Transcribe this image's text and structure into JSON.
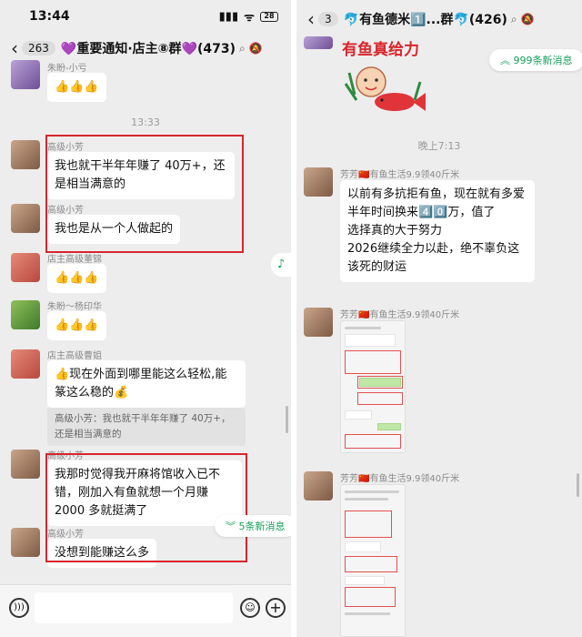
{
  "left": {
    "status": {
      "time": "13:44",
      "battery": "28"
    },
    "header": {
      "back_count": "263",
      "title": "💜重要通知·店主⑧群💜(473)"
    },
    "top_partial_name": "朱盼-小亏",
    "top_partial_text": "👍👍👍",
    "timestamp": "13:33",
    "messages": [
      {
        "name": "高级小芳",
        "text": "我也就干半年年赚了 40万+，还是相当满意的"
      },
      {
        "name": "高级小芳",
        "text": "我也是从一个人做起的"
      },
      {
        "name": "店主高级董锦",
        "text": "👍👍👍"
      },
      {
        "name": "朱盼～杨印华",
        "text": "👍👍👍"
      },
      {
        "name": "店主高级曹姐",
        "text": "👍现在外面到哪里能这么轻松,能篆这么稳的💰"
      },
      {
        "name": "高级小芳",
        "text": "我那时觉得我开麻将馆收入已不错，刚加入有鱼就想一个月赚 2000 多就挺满了"
      },
      {
        "name": "高级小芳",
        "text": "没想到能赚这么多"
      }
    ],
    "quote": "高级小芳：我也就干半年年赚了 40万+，还是相当满意的",
    "new_messages": "5条新消息"
  },
  "right": {
    "status": {
      "back_count": "3"
    },
    "header": {
      "title": "🐬有鱼德米1️⃣...群🐬(426)"
    },
    "sticker_text": "有鱼真给力",
    "new_messages": "999条新消息",
    "timestamp": "晚上7:13",
    "messages": [
      {
        "name": "芳芳🇨🇳有鱼生活9.9领40斤米",
        "text": "以前有多抗拒有鱼，现在就有多爱\n半年时间换来4️⃣0️⃣万，值了\n选择真的大于努力\n2026继续全力以赴，绝不辜负这该死的财运"
      },
      {
        "name": "芳芳🇨🇳有鱼生活9.9领40斤米",
        "text": ""
      },
      {
        "name": "芳芳🇨🇳有鱼生活9.9领40斤米",
        "text": ""
      }
    ]
  }
}
